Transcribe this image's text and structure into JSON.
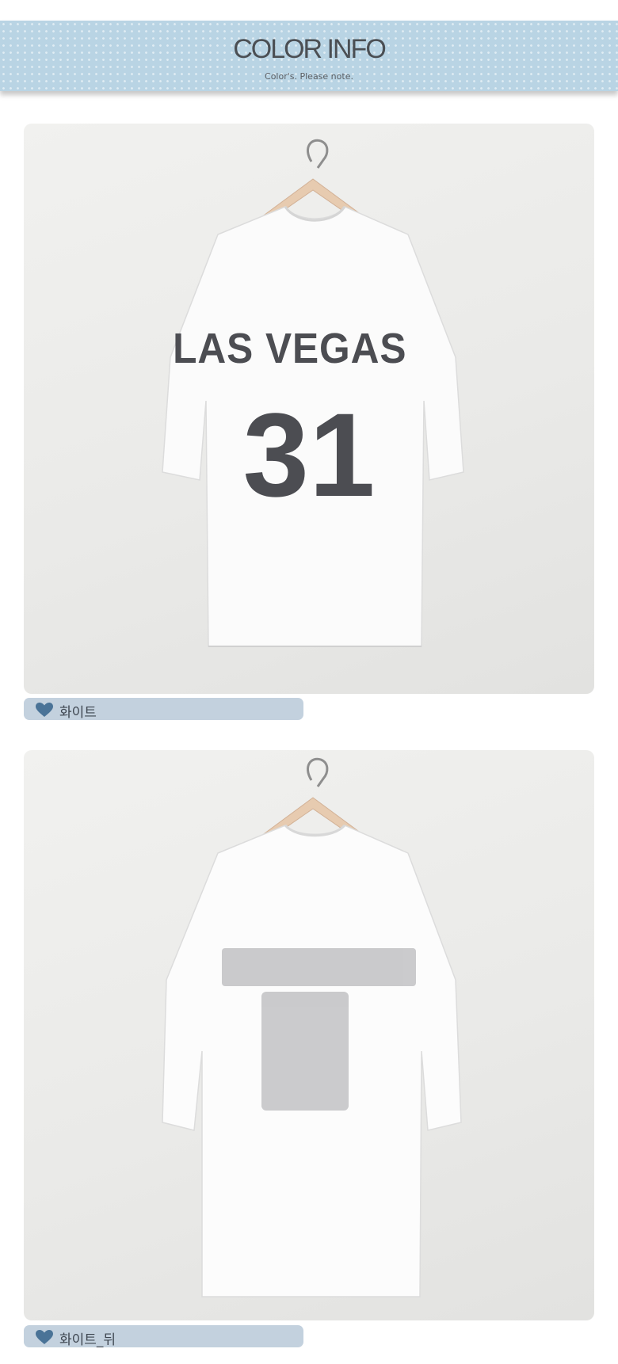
{
  "header": {
    "title": "COLOR INFO",
    "subtitle": "Color's. Please note."
  },
  "products": [
    {
      "label": "화이트",
      "shirt_print_text": "LAS VEGAS",
      "shirt_print_number": "31",
      "view": "front"
    },
    {
      "label": "화이트_뒤",
      "view": "back"
    }
  ],
  "colors": {
    "banner": "#b9d4e4",
    "label_bar": "#c3d1de",
    "heart": "#4a7397",
    "print": "#4c4d52"
  },
  "icons": {
    "label_icon": "heart-icon"
  }
}
